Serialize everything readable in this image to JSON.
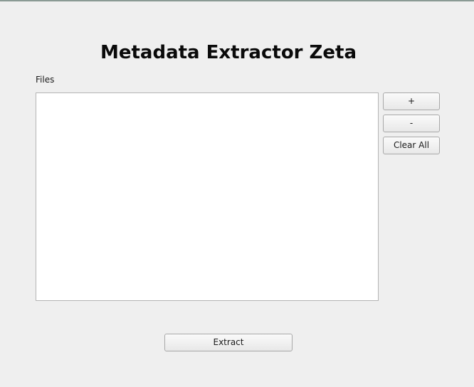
{
  "window": {
    "title": "Metadata Extractor Zeta"
  },
  "files": {
    "label": "Files",
    "items": []
  },
  "buttons": {
    "add": "+",
    "remove": "-",
    "clear_all": "Clear All",
    "extract": "Extract"
  }
}
